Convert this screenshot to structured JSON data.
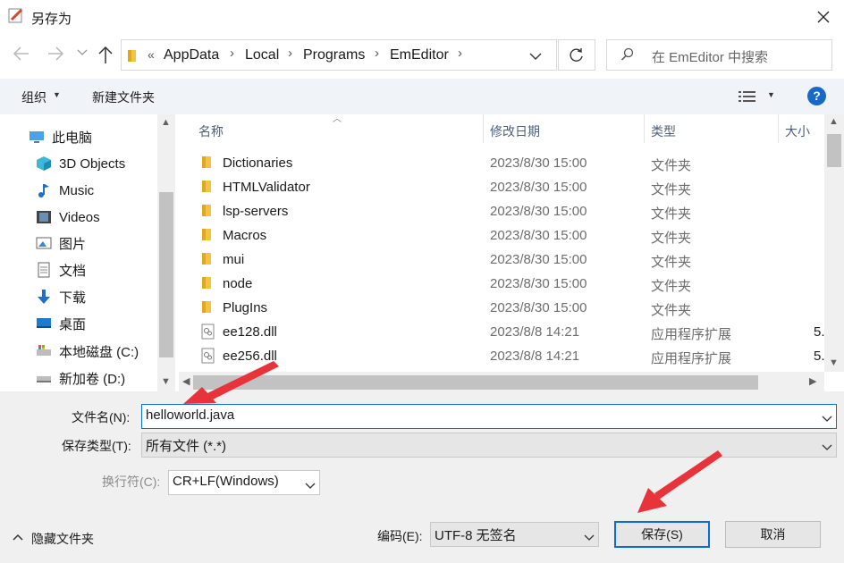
{
  "window": {
    "title": "另存为"
  },
  "address": {
    "overflow": "«",
    "crumbs": [
      "AppData",
      "Local",
      "Programs",
      "EmEditor"
    ],
    "separator": "›"
  },
  "search": {
    "placeholder": "在 EmEditor 中搜索"
  },
  "toolbar": {
    "organize": "组织",
    "new_folder": "新建文件夹",
    "help": "?"
  },
  "nav_items": [
    {
      "label": "此电脑",
      "icon": "pc-icon"
    },
    {
      "label": "3D Objects",
      "icon": "3d-objects-icon"
    },
    {
      "label": "Music",
      "icon": "music-icon"
    },
    {
      "label": "Videos",
      "icon": "videos-icon"
    },
    {
      "label": "图片",
      "icon": "pictures-icon"
    },
    {
      "label": "文档",
      "icon": "documents-icon"
    },
    {
      "label": "下载",
      "icon": "downloads-icon"
    },
    {
      "label": "桌面",
      "icon": "desktop-icon"
    },
    {
      "label": "本地磁盘 (C:)",
      "icon": "drive-c-icon"
    },
    {
      "label": "新加卷 (D:)",
      "icon": "drive-d-icon"
    }
  ],
  "columns": {
    "name": "名称",
    "modified": "修改日期",
    "type": "类型",
    "size": "大小"
  },
  "files": [
    {
      "name": "Dictionaries",
      "modified": "2023/8/30 15:00",
      "type": "文件夹",
      "size": "",
      "kind": "folder"
    },
    {
      "name": "HTMLValidator",
      "modified": "2023/8/30 15:00",
      "type": "文件夹",
      "size": "",
      "kind": "folder"
    },
    {
      "name": "lsp-servers",
      "modified": "2023/8/30 15:00",
      "type": "文件夹",
      "size": "",
      "kind": "folder"
    },
    {
      "name": "Macros",
      "modified": "2023/8/30 15:00",
      "type": "文件夹",
      "size": "",
      "kind": "folder"
    },
    {
      "name": "mui",
      "modified": "2023/8/30 15:00",
      "type": "文件夹",
      "size": "",
      "kind": "folder"
    },
    {
      "name": "node",
      "modified": "2023/8/30 15:00",
      "type": "文件夹",
      "size": "",
      "kind": "folder"
    },
    {
      "name": "PlugIns",
      "modified": "2023/8/30 15:00",
      "type": "文件夹",
      "size": "",
      "kind": "folder"
    },
    {
      "name": "ee128.dll",
      "modified": "2023/8/8 14:21",
      "type": "应用程序扩展",
      "size": "5.",
      "kind": "dll"
    },
    {
      "name": "ee256.dll",
      "modified": "2023/8/8 14:21",
      "type": "应用程序扩展",
      "size": "5.",
      "kind": "dll"
    }
  ],
  "form": {
    "filename_label": "文件名(N):",
    "filename_value": "helloworld.java",
    "filetype_label": "保存类型(T):",
    "filetype_value": "所有文件 (*.*)",
    "linebreak_label": "换行符(C):",
    "linebreak_value": "CR+LF(Windows)",
    "encoding_label": "编码(E):",
    "encoding_value": "UTF-8 无签名",
    "hide_folders": "隐藏文件夹",
    "save": "保存(S)",
    "cancel": "取消"
  },
  "colors": {
    "accent": "#0a6bd6",
    "annotation": "#e8333a",
    "folder": "#f5c242"
  }
}
